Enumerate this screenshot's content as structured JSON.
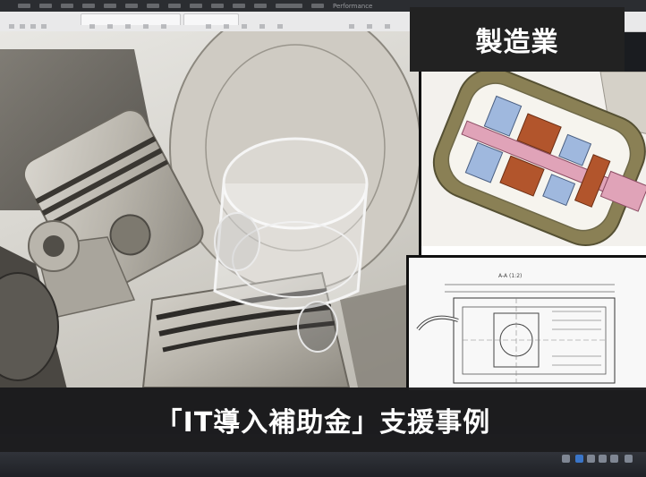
{
  "category_badge": {
    "label": "製造業"
  },
  "title_banner": {
    "text": "「IT導入補助金」支援事例"
  },
  "cad_app": {
    "menu_tab_label": "Performance",
    "colors": {
      "background": "#1a1c20",
      "badge_bg": "#222222",
      "banner_bg": "#1c1c1e",
      "accent_blue": "#3a75c8",
      "part_pink": "#e0a3b8",
      "part_blue": "#9fb8de",
      "part_rust": "#b2552c",
      "housing_olive": "#8a8055"
    },
    "drawing_labels": [
      "A-A (1:2)"
    ]
  }
}
